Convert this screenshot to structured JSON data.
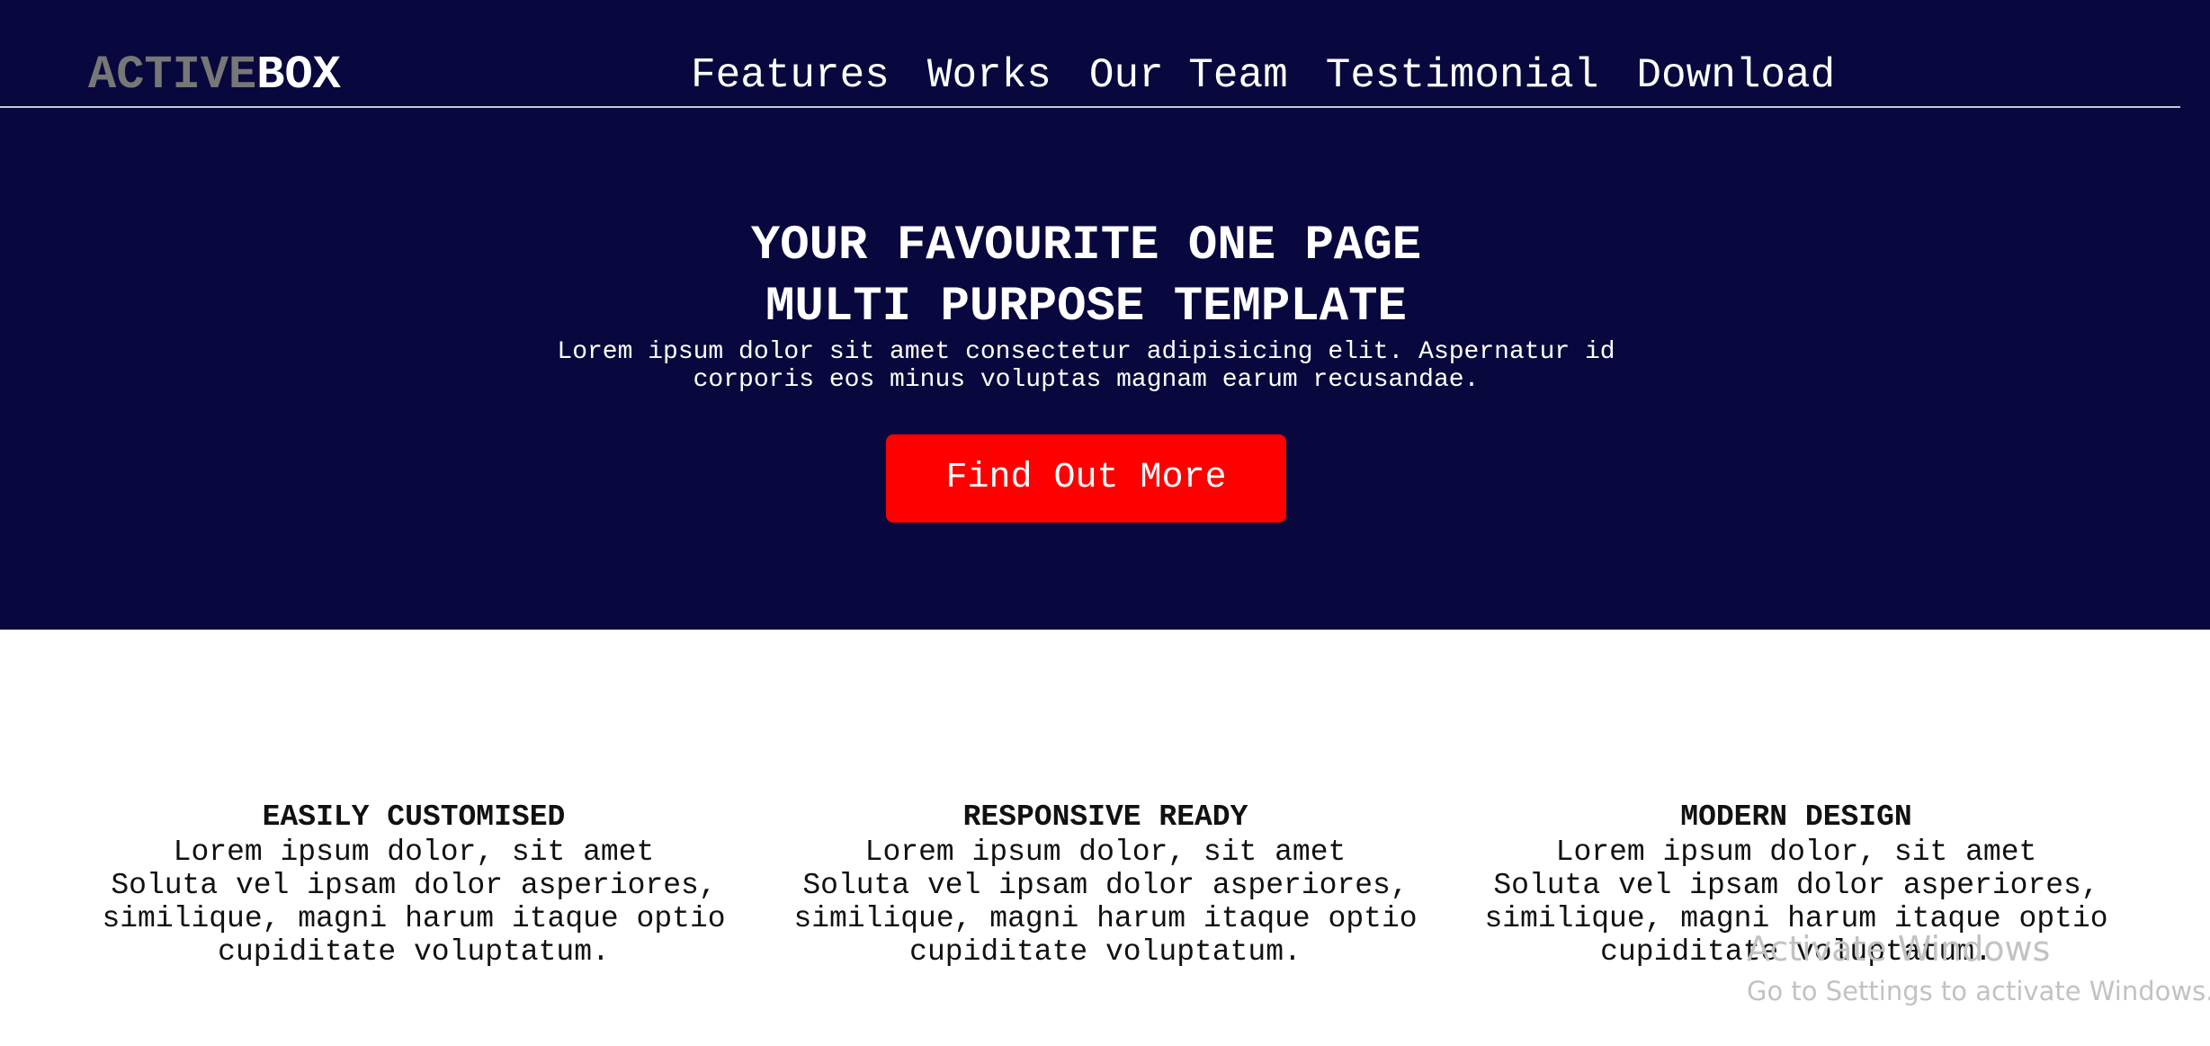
{
  "header": {
    "logo_part1": "ACTIVE",
    "logo_part2": "BOX",
    "nav": [
      "Features",
      "Works",
      "Our Team",
      "Testimonial",
      "Download"
    ]
  },
  "hero": {
    "title_line1": "YOUR FAVOURITE ONE PAGE",
    "title_line2": "MULTI PURPOSE TEMPLATE",
    "subtitle_line1": "Lorem ipsum dolor sit amet consectetur adipisicing elit. Aspernatur id",
    "subtitle_line2": "corporis eos minus voluptas magnam earum recusandae.",
    "cta_label": "Find Out More"
  },
  "features": [
    {
      "title": "EASILY CUSTOMISED",
      "lines": [
        "Lorem ipsum dolor, sit amet",
        "Soluta vel ipsam dolor asperiores,",
        "similique, magni harum itaque optio",
        "cupiditate voluptatum."
      ]
    },
    {
      "title": "RESPONSIVE READY",
      "lines": [
        "Lorem ipsum dolor, sit amet",
        "Soluta vel ipsam dolor asperiores,",
        "similique, magni harum itaque optio",
        "cupiditate voluptatum."
      ]
    },
    {
      "title": "MODERN DESIGN",
      "lines": [
        "Lorem ipsum dolor, sit amet",
        "Soluta vel ipsam dolor asperiores,",
        "similique, magni harum itaque optio",
        "cupiditate voluptatum."
      ]
    }
  ],
  "watermark": {
    "line1": "Activate Windows",
    "line2": "Go to Settings to activate Windows."
  },
  "colors": {
    "hero_background": "#08083e",
    "cta_background": "#ff0000",
    "logo_muted": "#777777"
  }
}
